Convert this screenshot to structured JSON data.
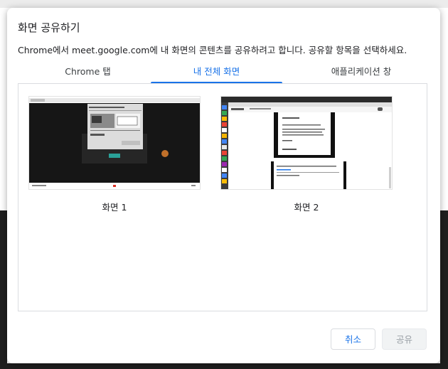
{
  "dialog": {
    "title": "화면 공유하기",
    "message": "Chrome에서 meet.google.com에 내 화면의 콘텐츠를 공유하려고 합니다. 공유할 항목을 선택하세요."
  },
  "tabs": [
    {
      "label": "Chrome 탭",
      "active": false
    },
    {
      "label": "내 전체 화면",
      "active": true
    },
    {
      "label": "애플리케이션 창",
      "active": false
    }
  ],
  "screens": [
    {
      "label": "화면 1"
    },
    {
      "label": "화면 2"
    }
  ],
  "buttons": {
    "cancel": "취소",
    "share": "공유"
  },
  "colors": {
    "accent": "#1a73e8",
    "disabled_bg": "#f1f3f4",
    "disabled_text": "#9aa0a6",
    "border": "#dadce0"
  }
}
